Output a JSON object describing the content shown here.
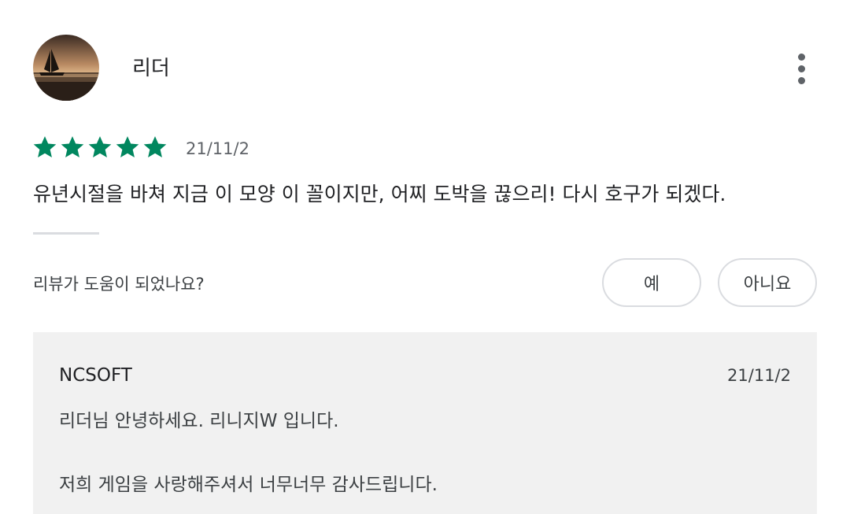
{
  "review": {
    "author": "리더",
    "avatar_icon": "sunset-silhouette-avatar",
    "rating": 5,
    "rating_max": 5,
    "star_color": "#01875f",
    "date": "21/11/2",
    "text": "유년시절을 바쳐 지금 이 모양 이 꼴이지만, 어찌 도박을 끊으리! 다시 호구가 되겠다.",
    "more_icon": "more-vert-icon"
  },
  "helpful": {
    "question": "리뷰가 도움이 되었나요?",
    "yes_label": "예",
    "no_label": "아니요"
  },
  "developer_reply": {
    "author": "NCSOFT",
    "date": "21/11/2",
    "lines": [
      "리더님 안녕하세요. 리니지W 입니다.",
      "저희 게임을 사랑해주셔서 너무너무 감사드립니다."
    ]
  }
}
